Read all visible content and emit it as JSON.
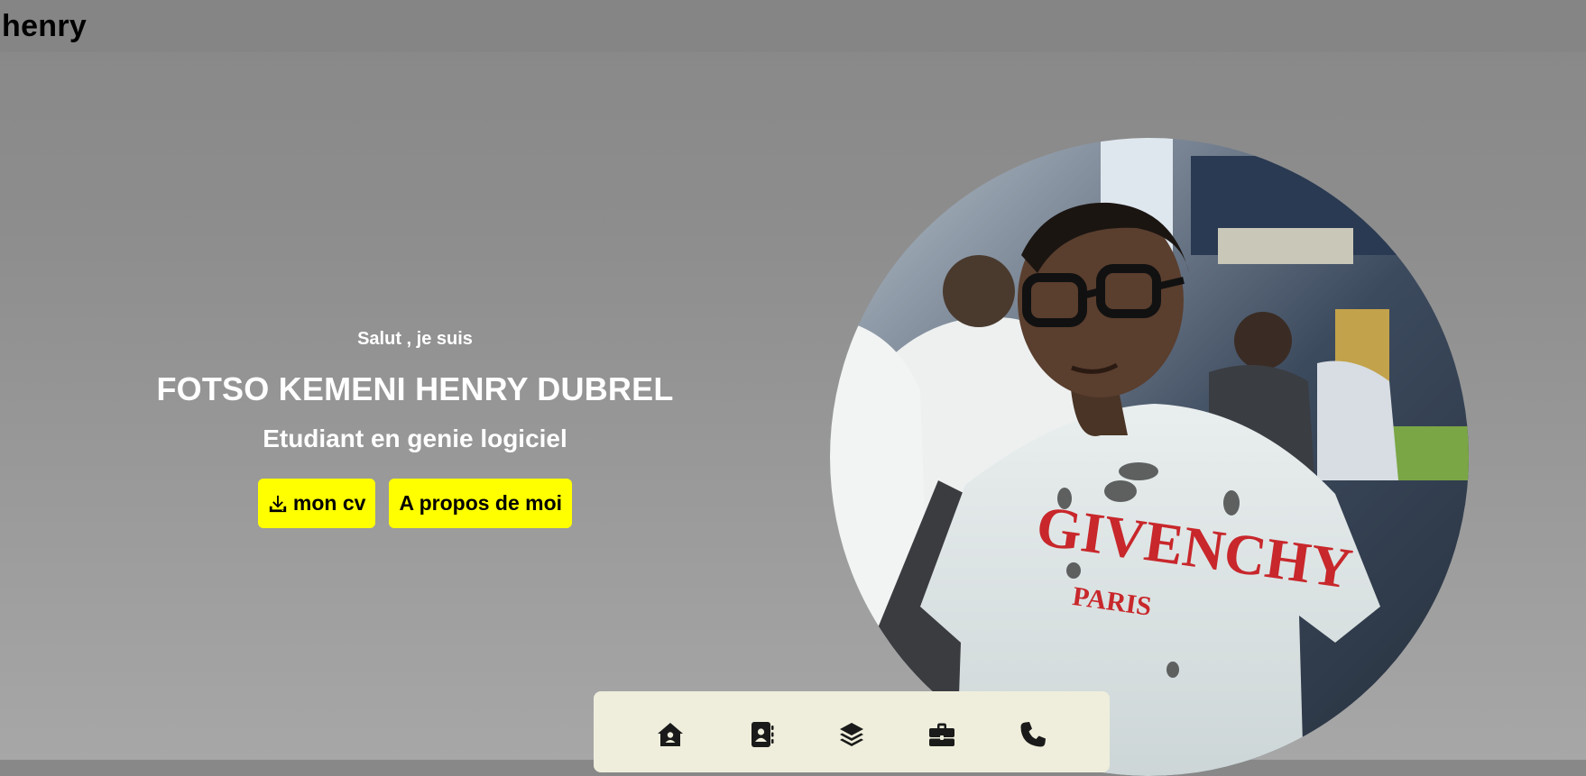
{
  "header": {
    "brand": "henry"
  },
  "hero": {
    "greeting": "Salut , je suis",
    "name": "FOTSO KEMENI HENRY DUBREL",
    "role": "Etudiant en genie logiciel",
    "cv_button": {
      "label": "mon cv",
      "icon": "download-icon"
    },
    "about_button": {
      "label": "A propos de moi"
    }
  },
  "portrait": {
    "shirt_text": "GIVENCHY",
    "shirt_subtext": "PARIS"
  },
  "dock": {
    "items": [
      {
        "icon": "home-icon"
      },
      {
        "icon": "contact-book-icon"
      },
      {
        "icon": "layers-icon"
      },
      {
        "icon": "briefcase-icon"
      },
      {
        "icon": "phone-icon"
      }
    ]
  },
  "colors": {
    "accent": "#ffff00",
    "dock_background": "#efeedc",
    "text_light": "#ffffff",
    "icon_dark": "#1a1a1a"
  }
}
